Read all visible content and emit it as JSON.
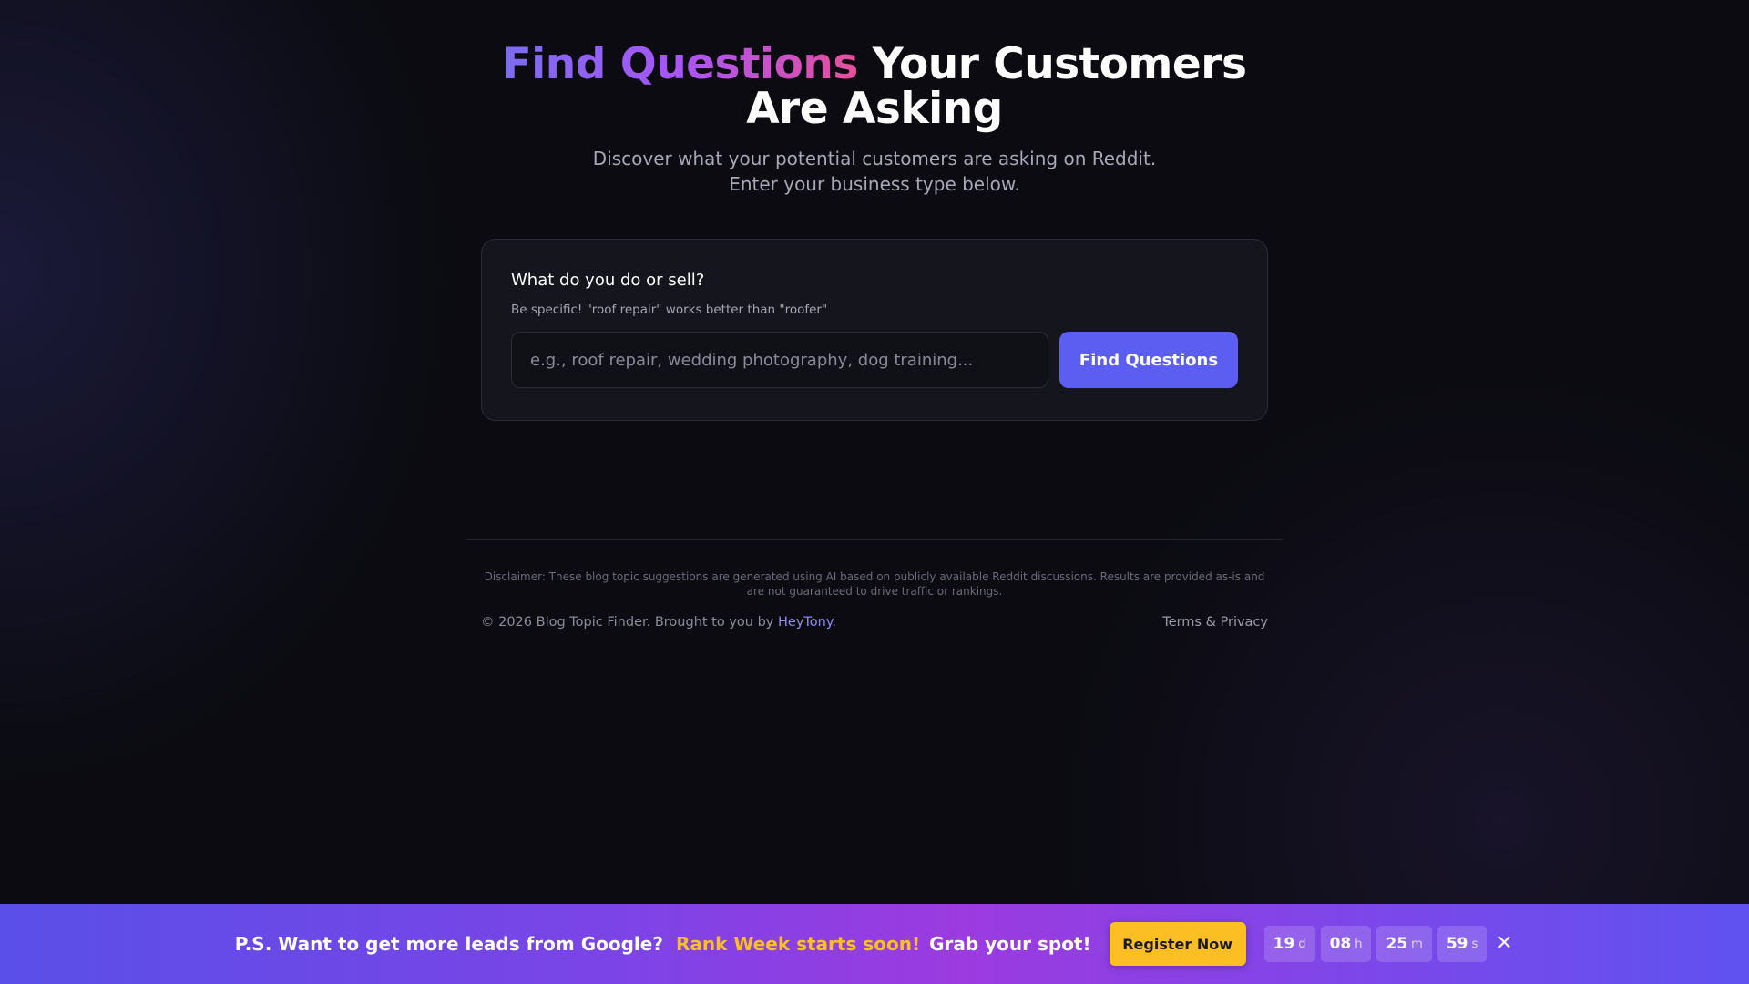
{
  "hero": {
    "title_highlight": "Find Questions",
    "title_rest": "Your Customers Are Asking",
    "subtitle": "Discover what your potential customers are asking on Reddit. Enter your business type below."
  },
  "form": {
    "label": "What do you do or sell?",
    "hint": "Be specific! \"roof repair\" works better than \"roofer\"",
    "input_value": "",
    "input_placeholder": "e.g., roof repair, wedding photography, dog training...",
    "submit_label": "Find Questions"
  },
  "footer": {
    "disclaimer": "Disclaimer: These blog topic suggestions are generated using AI based on publicly available Reddit discussions. Results are provided as-is and are not guaranteed to drive traffic or rankings.",
    "copyright_prefix": "© 2026 Blog Topic Finder. Brought to you by",
    "brand_link": "HeyTony",
    "copyright_suffix": ".",
    "terms_link": "Terms & Privacy"
  },
  "banner": {
    "lead": "P.S. Want to get more leads from Google?",
    "highlight": "Rank Week starts soon!",
    "tail": "Grab your spot!",
    "register_label": "Register Now",
    "countdown": [
      {
        "value": "19",
        "unit": "d"
      },
      {
        "value": "08",
        "unit": "h"
      },
      {
        "value": "25",
        "unit": "m"
      },
      {
        "value": "59",
        "unit": "s"
      }
    ],
    "close_icon": "close-icon",
    "accent_color": "#fbbf24"
  },
  "colors": {
    "background": "#0b0b11",
    "primary_button": "#5b5ef0",
    "link": "#8b8cf5"
  }
}
